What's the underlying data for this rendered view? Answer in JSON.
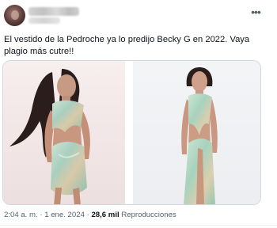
{
  "post": {
    "text": "El vestido de la Pedroche ya lo predijo Becky G en 2022. Vaya plagio más cutre!!",
    "more_icon": "more-horizontal-icon",
    "more_glyph": "•••",
    "media": [
      {
        "name": "photo-becky-g"
      },
      {
        "name": "photo-pedroche"
      }
    ],
    "time": "2:04 a. m.",
    "separator": "·",
    "date": "1 ene. 2024",
    "views_count": "28,6 mil",
    "views_label": "Reproducciones"
  }
}
